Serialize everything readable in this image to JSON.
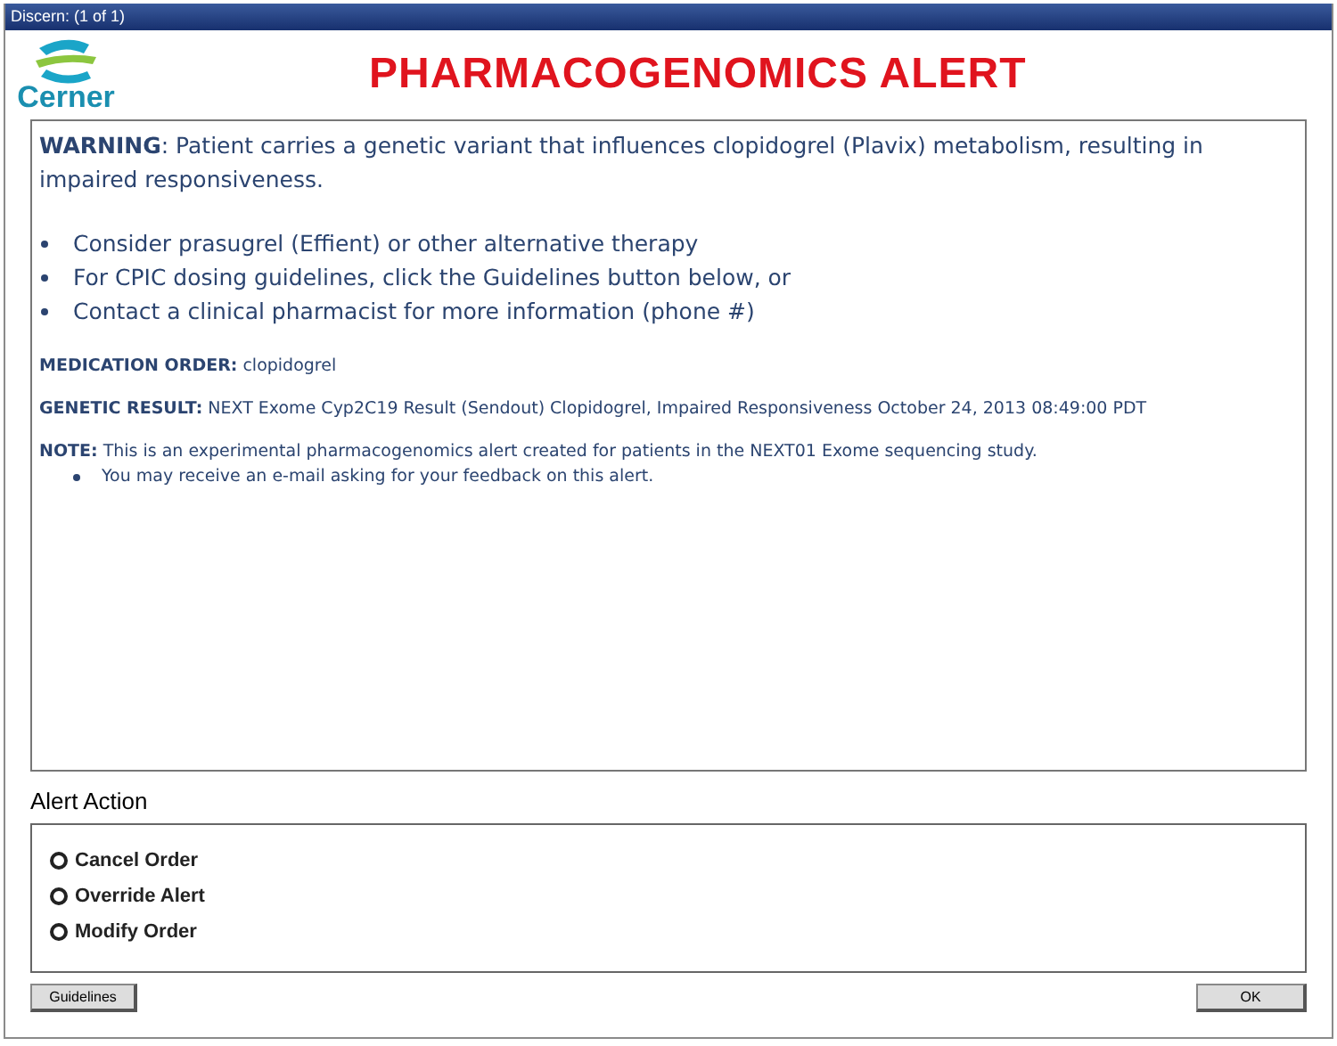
{
  "window": {
    "title": "Discern: (1 of 1)"
  },
  "logo": {
    "text": "Cerner"
  },
  "heading": "PHARMACOGENOMICS ALERT",
  "message": {
    "warning": "**WARNING**: Patient carries a genetic variant that influences clopidogrel (Plavix) metabolism, resulting in impaired responsiveness.",
    "bullets": [
      "Consider prasugrel (Effient) or other alternative therapy",
      "For CPIC dosing guidelines, click the Guidelines button below, or",
      "Contact a clinical pharmacist for more information (phone #)"
    ],
    "medication_order": "**MEDICATION ORDER:** clopidogrel",
    "genetic_result": "**GENETIC RESULT:** NEXT Exome Cyp2C19 Result (Sendout) Clopidogrel, Impaired Responsiveness October 24, 2013 08:49:00 PDT",
    "note": "**NOTE:** This is an experimental pharmacogenomics alert created for patients in the NEXT01 Exome sequencing study.",
    "note_bullets": [
      "You may receive an e-mail asking for your feedback on this alert."
    ]
  },
  "alert_action": {
    "label": "Alert Action",
    "options": [
      {
        "label": "Cancel Order",
        "selected": false
      },
      {
        "label": "Override Alert",
        "selected": false
      },
      {
        "label": "Modify Order",
        "selected": false
      }
    ]
  },
  "buttons": [
    "Guidelines",
    "OK"
  ]
}
